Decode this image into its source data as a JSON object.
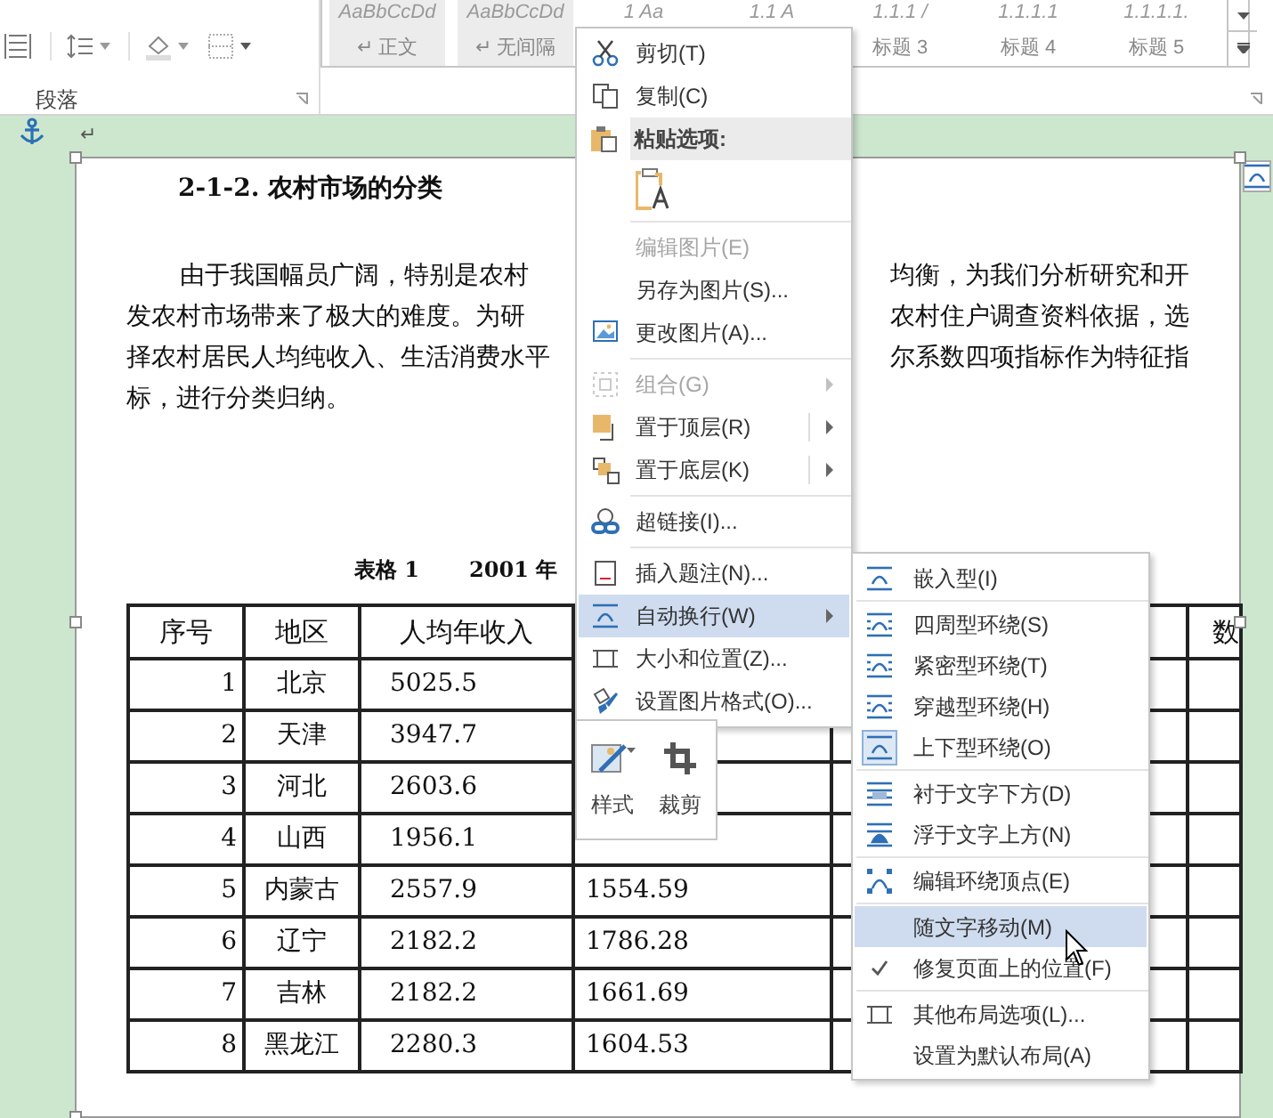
{
  "ribbon": {
    "paragraph_group": {
      "label": "段落"
    },
    "styles_gallery": [
      {
        "preview": "AaBbCcDd",
        "label": "正文",
        "return_mark": "↵"
      },
      {
        "preview": "AaBbCcDd",
        "label": "无间隔",
        "return_mark": "↵"
      },
      {
        "preview": "1 Aa"
      },
      {
        "preview": "1.1 A"
      },
      {
        "preview": "1.1.1 /",
        "label": "标题 3"
      },
      {
        "preview": "1.1.1.1",
        "label": "标题 4"
      },
      {
        "preview": "1.1.1.1.",
        "label": "标题 5"
      }
    ]
  },
  "document": {
    "return_mark": "↵",
    "heading": "2-1-2. 农村市场的分类",
    "paragraph_lines": [
      {
        "left": "由于我国幅员广阔，特别是农村",
        "right": "均衡，为我们分析研究和开"
      },
      {
        "left": "发农村市场带来了极大的难度。为研",
        "right": "农村住户调查资料依据，选"
      },
      {
        "left": "择农村居民人均纯收入、生活消费水平",
        "right": "尔系数四项指标作为特征指"
      },
      {
        "left": "标，进行分类归纳。"
      }
    ],
    "caption": [
      "表格 1",
      "2001 年"
    ],
    "table": {
      "columns": [
        "序号",
        "地区",
        "人均年收入"
      ],
      "column_6": "数",
      "rows": [
        {
          "no": "1",
          "region": "北京",
          "income": "5025.5"
        },
        {
          "no": "2",
          "region": "天津",
          "income": "3947.7"
        },
        {
          "no": "3",
          "region": "河北",
          "income": "2603.6"
        },
        {
          "no": "4",
          "region": "山西",
          "income": "1956.1"
        },
        {
          "no": "5",
          "region": "内蒙古",
          "income": "2557.9",
          "column_4": "1554.59"
        },
        {
          "no": "6",
          "region": "辽宁",
          "income": "2182.2",
          "column_4": "1786.28"
        },
        {
          "no": "7",
          "region": "吉林",
          "income": "2182.2",
          "column_4": "1661.69"
        },
        {
          "no": "8",
          "region": "黑龙江",
          "income": "2280.3",
          "column_4": "1604.53"
        }
      ]
    }
  },
  "context_menu": {
    "items": [
      {
        "kind": "item",
        "label": "剪切(T)",
        "disabled": false,
        "highlighted": false
      },
      {
        "kind": "item",
        "label": "复制(C)",
        "disabled": false,
        "highlighted": false
      },
      {
        "kind": "header",
        "label": "粘贴选项:"
      },
      {
        "kind": "paste_options"
      },
      {
        "kind": "separator"
      },
      {
        "kind": "item",
        "label": "编辑图片(E)",
        "disabled": true,
        "highlighted": false
      },
      {
        "kind": "item",
        "label": "另存为图片(S)...",
        "disabled": false,
        "highlighted": false
      },
      {
        "kind": "item",
        "label": "更改图片(A)...",
        "disabled": false,
        "highlighted": false
      },
      {
        "kind": "separator"
      },
      {
        "kind": "item",
        "label": "组合(G)",
        "disabled": true,
        "highlighted": false,
        "submenu": true,
        "split": false
      },
      {
        "kind": "item",
        "label": "置于顶层(R)",
        "disabled": false,
        "highlighted": false,
        "submenu": true,
        "split": true
      },
      {
        "kind": "item",
        "label": "置于底层(K)",
        "disabled": false,
        "highlighted": false,
        "submenu": true,
        "split": true
      },
      {
        "kind": "separator"
      },
      {
        "kind": "item",
        "label": "超链接(I)...",
        "disabled": false,
        "highlighted": false
      },
      {
        "kind": "separator"
      },
      {
        "kind": "item",
        "label": "插入题注(N)...",
        "disabled": false,
        "highlighted": false
      },
      {
        "kind": "item",
        "label": "自动换行(W)",
        "disabled": false,
        "highlighted": true,
        "submenu": true,
        "split": false
      },
      {
        "kind": "item",
        "label": "大小和位置(Z)...",
        "disabled": false,
        "highlighted": false
      },
      {
        "kind": "item",
        "label": "设置图片格式(O)...",
        "disabled": false,
        "highlighted": false
      }
    ]
  },
  "mini_toolbar": {
    "buttons": [
      {
        "label": "样式"
      },
      {
        "label": "裁剪"
      }
    ]
  },
  "wrap_submenu": {
    "items": [
      {
        "kind": "wrap",
        "label": "嵌入型(I)",
        "selected": false,
        "highlighted": false
      },
      {
        "kind": "separator"
      },
      {
        "kind": "wrap",
        "label": "四周型环绕(S)",
        "selected": false,
        "highlighted": false
      },
      {
        "kind": "wrap",
        "label": "紧密型环绕(T)",
        "selected": false,
        "highlighted": false
      },
      {
        "kind": "wrap",
        "label": "穿越型环绕(H)",
        "selected": false,
        "highlighted": false
      },
      {
        "kind": "wrap",
        "label": "上下型环绕(O)",
        "selected": true,
        "highlighted": false
      },
      {
        "kind": "separator"
      },
      {
        "kind": "wrap",
        "label": "衬于文字下方(D)",
        "selected": false,
        "highlighted": false
      },
      {
        "kind": "wrap",
        "label": "浮于文字上方(N)",
        "selected": false,
        "highlighted": false
      },
      {
        "kind": "separator"
      },
      {
        "kind": "action",
        "label": "编辑环绕顶点(E)",
        "highlighted": false
      },
      {
        "kind": "separator"
      },
      {
        "kind": "option",
        "label": "随文字移动(M)",
        "checked": false,
        "highlighted": true
      },
      {
        "kind": "option",
        "label": "修复页面上的位置(F)",
        "checked": true,
        "highlighted": false
      },
      {
        "kind": "separator"
      },
      {
        "kind": "action",
        "label": "其他布局选项(L)...",
        "highlighted": false
      },
      {
        "kind": "action",
        "label": "设置为默认布局(A)",
        "highlighted": false
      }
    ]
  }
}
